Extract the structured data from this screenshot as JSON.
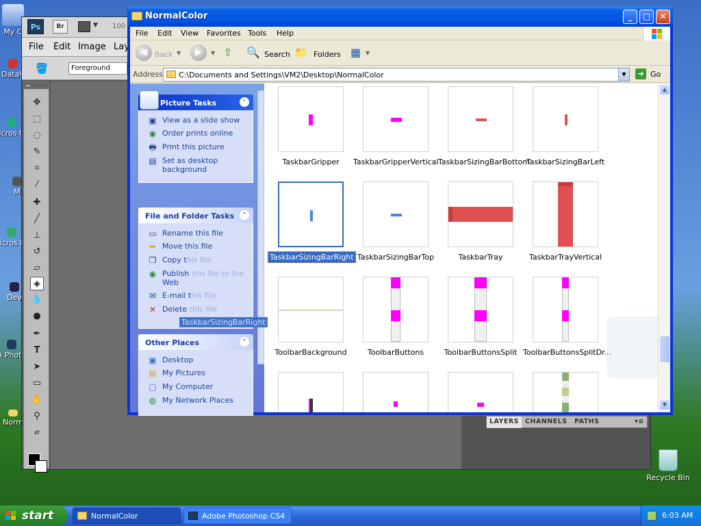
{
  "desktop": {
    "icons": [
      {
        "label": "My C"
      },
      {
        "label": "DataV"
      },
      {
        "label": "Micros C+"
      },
      {
        "label": "M"
      },
      {
        "label": "Micros Ba"
      },
      {
        "label": "Dev"
      },
      {
        "label": "A Photo"
      },
      {
        "label": "Norm"
      }
    ],
    "recycle_bin": "Recycle Bin"
  },
  "photoshop": {
    "logo": "Ps",
    "bridge": "Br",
    "zoom": "100",
    "menu": [
      "File",
      "Edit",
      "Image",
      "Laye"
    ],
    "fill_source": "Foreground",
    "panel_tabs": [
      "LAYERS",
      "CHANNELS",
      "PATHS"
    ],
    "toolbox_head": "▸▸"
  },
  "explorer": {
    "title": "NormalColor",
    "caption_buttons": {
      "minimize": "_",
      "maximize": "□",
      "close": "✕"
    },
    "menu": [
      "File",
      "Edit",
      "View",
      "Favorites",
      "Tools",
      "Help"
    ],
    "toolbar": {
      "back": "Back",
      "search": "Search",
      "folders": "Folders"
    },
    "address": {
      "label": "Address",
      "path": "C:\\Documents and Settings\\VM2\\Desktop\\NormalColor",
      "go": "Go"
    },
    "picture_tasks": {
      "title": "Picture Tasks",
      "items": [
        "View as a slide show",
        "Order prints online",
        "Print this picture",
        "Set as desktop background"
      ]
    },
    "file_folder_tasks": {
      "title": "File and Folder Tasks",
      "items": [
        {
          "pre": "Rename this file",
          "dim": ""
        },
        {
          "pre": "Move this file",
          "dim": ""
        },
        {
          "pre": "Copy t",
          "dim": "his file"
        },
        {
          "pre": "Publish ",
          "dim": "this file to the",
          "post": "Web"
        },
        {
          "pre": "E-mail t",
          "dim": "his file"
        },
        {
          "pre": "Delete ",
          "dim": "this file"
        }
      ]
    },
    "other_places": {
      "title": "Other Places",
      "items": [
        "Desktop",
        "My Pictures",
        "My Computer",
        "My Network Places"
      ]
    },
    "drag_ghost": "TaskbarSizingBarRight",
    "files": [
      {
        "name": "TaskbarGripper"
      },
      {
        "name": "TaskbarGripperVertical"
      },
      {
        "name": "TaskbarSizingBarBottom"
      },
      {
        "name": "TaskbarSizingBarLeft"
      },
      {
        "name": "TaskbarSizingBarRight",
        "selected": true
      },
      {
        "name": "TaskbarSizingBarTop"
      },
      {
        "name": "TaskbarTray"
      },
      {
        "name": "TaskbarTrayVertical"
      },
      {
        "name": "ToolbarBackground"
      },
      {
        "name": "ToolbarButtons"
      },
      {
        "name": "ToolbarButtonsSplit"
      },
      {
        "name": "ToolbarButtonsSplitDr..."
      },
      {
        "name": ""
      },
      {
        "name": ""
      },
      {
        "name": ""
      },
      {
        "name": ""
      }
    ]
  },
  "taskbar": {
    "start": "start",
    "buttons": [
      {
        "label": "NormalColor",
        "active": true
      },
      {
        "label": "Adobe Photoshop CS4",
        "active": false
      }
    ],
    "clock": "6:03 AM"
  },
  "colors": {
    "magenta": "#ff00ff",
    "red_tray": "#e05050",
    "selection": "#316ac5",
    "xp_blue": "#0055e5"
  }
}
